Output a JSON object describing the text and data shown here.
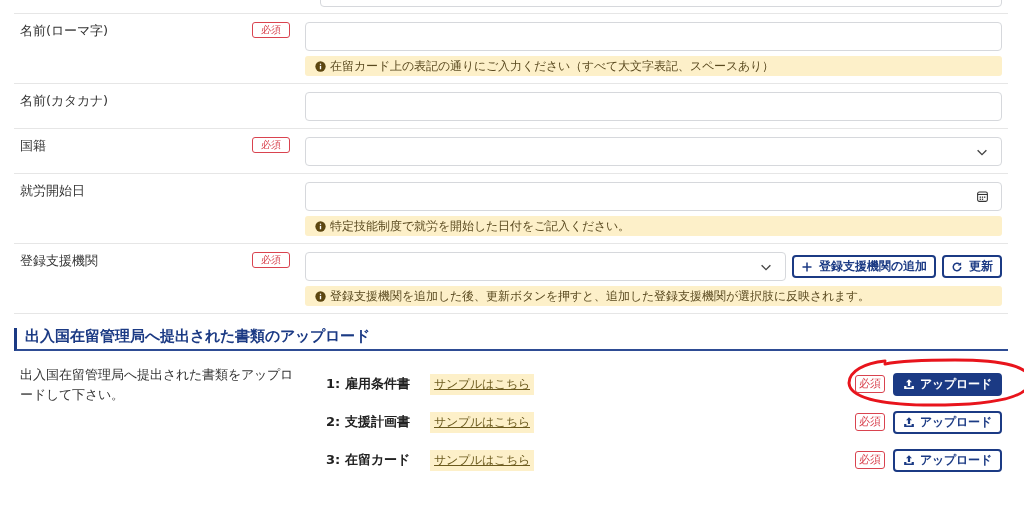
{
  "cut_field": {
    "kind": "text"
  },
  "form_rows": [
    {
      "label": "名前(ローマ字)",
      "required_badge": "必須",
      "field": {
        "kind": "text"
      },
      "note": "在留カード上の表記の通りにご入力ください（すべて大文字表記、スペースあり）"
    },
    {
      "label": "名前(カタカナ)",
      "field": {
        "kind": "text"
      }
    },
    {
      "label": "国籍",
      "required_badge": "必須",
      "field": {
        "kind": "select"
      }
    },
    {
      "label": "就労開始日",
      "field": {
        "kind": "date"
      },
      "note": "特定技能制度で就労を開始した日付をご記入ください。"
    },
    {
      "label": "登録支援機関",
      "required_badge": "必須",
      "field": {
        "kind": "select"
      },
      "buttons": [
        {
          "label": "登録支援機関の追加"
        },
        {
          "label": "更新"
        }
      ],
      "note": "登録支援機関を追加した後、更新ボタンを押すと、追加した登録支援機関が選択肢に反映されます。"
    }
  ],
  "upload_section": {
    "title": "出入国在留管理局へ提出された書類のアップロード",
    "description": "出入国在留管理局へ提出された書類をアップロードして下さい。",
    "documents": [
      {
        "name": "1: 雇用条件書",
        "sample_link": "サンプルはこちら",
        "required_badge": "必須",
        "upload_button": "アップロード",
        "highlighted": true,
        "circled": true
      },
      {
        "name": "2: 支援計画書",
        "sample_link": "サンプルはこちら",
        "required_badge": "必須",
        "upload_button": "アップロード",
        "highlighted": false,
        "circled": false
      },
      {
        "name": "3: 在留カード",
        "sample_link": "サンプルはこちら",
        "required_badge": "必須",
        "upload_button": "アップロード",
        "highlighted": false,
        "circled": false
      }
    ]
  }
}
